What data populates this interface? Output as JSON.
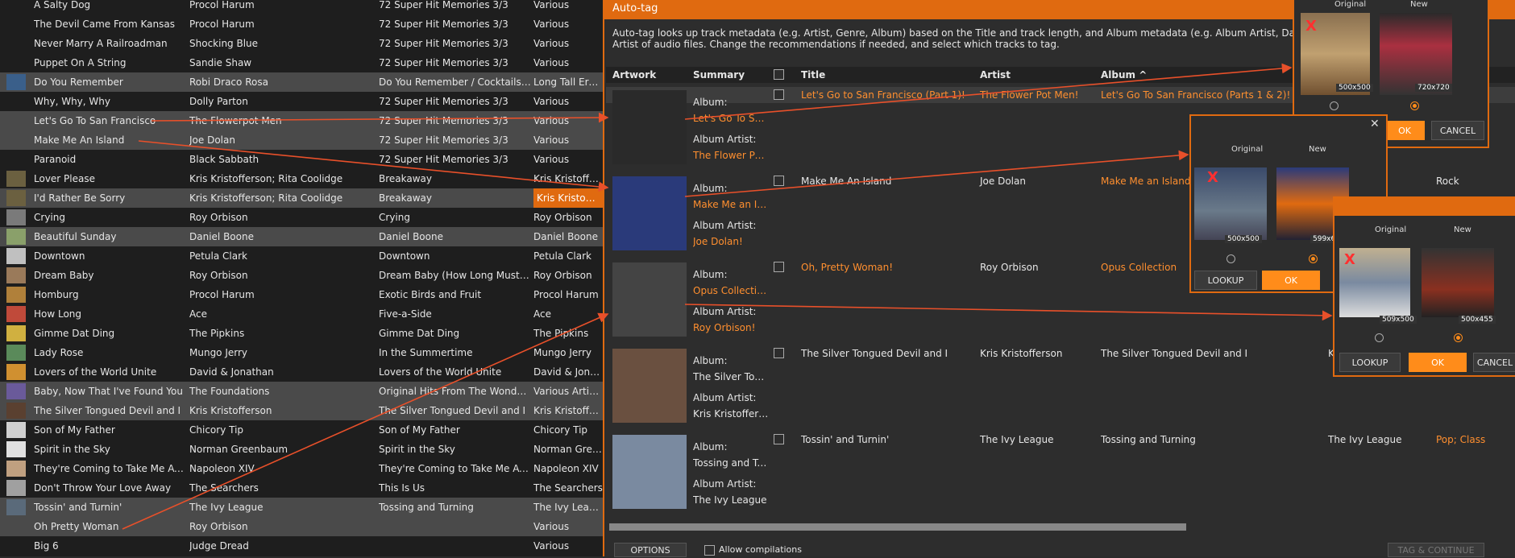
{
  "library": {
    "rows": [
      {
        "title": "A Salty Dog",
        "artist": "Procol Harum",
        "album": "72 Super Hit Memories 3/3",
        "album_artist": "Various",
        "selected": false,
        "thumb": ""
      },
      {
        "title": "The Devil Came From Kansas",
        "artist": "Procol Harum",
        "album": "72 Super Hit Memories 3/3",
        "album_artist": "Various",
        "selected": false,
        "thumb": ""
      },
      {
        "title": "Never Marry A Railroadman",
        "artist": "Shocking Blue",
        "album": "72 Super Hit Memories 3/3",
        "album_artist": "Various",
        "selected": false,
        "thumb": ""
      },
      {
        "title": "Puppet On A String",
        "artist": "Sandie Shaw",
        "album": "72 Super Hit Memories 3/3",
        "album_artist": "Various",
        "selected": false,
        "thumb": ""
      },
      {
        "title": "Do You Remember",
        "artist": "Robi Draco Rosa",
        "album": "Do You Remember / Cocktails At...",
        "album_artist": "Long Tall Ernie ...",
        "selected": true,
        "thumb": "#3a5f8a"
      },
      {
        "title": "Why, Why, Why",
        "artist": "Dolly Parton",
        "album": "72 Super Hit Memories 3/3",
        "album_artist": "Various",
        "selected": false,
        "thumb": ""
      },
      {
        "title": "Let's Go To San Francisco",
        "artist": "The Flowerpot Men",
        "album": "72 Super Hit Memories 3/3",
        "album_artist": "Various",
        "selected": true,
        "thumb": ""
      },
      {
        "title": "Make Me An Island",
        "artist": "Joe Dolan",
        "album": "72 Super Hit Memories 3/3",
        "album_artist": "Various",
        "selected": true,
        "thumb": ""
      },
      {
        "title": "Paranoid",
        "artist": "Black Sabbath",
        "album": "72 Super Hit Memories 3/3",
        "album_artist": "Various",
        "selected": false,
        "thumb": ""
      },
      {
        "title": "Lover Please",
        "artist": "Kris Kristofferson; Rita Coolidge",
        "album": "Breakaway",
        "album_artist": "Kris Kristoffers...",
        "selected": false,
        "thumb": "#6b6040"
      },
      {
        "title": "I'd Rather Be Sorry",
        "artist": "Kris Kristofferson; Rita Coolidge",
        "album": "Breakaway",
        "album_artist": "Kris Kristoffers...",
        "selected": true,
        "thumb": "#6b6040"
      },
      {
        "title": "Crying",
        "artist": "Roy Orbison",
        "album": "Crying",
        "album_artist": "Roy Orbison",
        "selected": false,
        "thumb": "#7a7a7a"
      },
      {
        "title": "Beautiful Sunday",
        "artist": "Daniel Boone",
        "album": "Daniel Boone",
        "album_artist": "Daniel Boone",
        "selected": true,
        "thumb": "#8aa06a"
      },
      {
        "title": "Downtown",
        "artist": "Petula Clark",
        "album": "Downtown",
        "album_artist": "Petula Clark",
        "selected": false,
        "thumb": "#c0c0c0"
      },
      {
        "title": "Dream Baby",
        "artist": "Roy Orbison",
        "album": "Dream Baby (How Long Must I Dr...",
        "album_artist": "Roy Orbison",
        "selected": false,
        "thumb": "#9a7a5a"
      },
      {
        "title": "Homburg",
        "artist": "Procol Harum",
        "album": "Exotic Birds and Fruit",
        "album_artist": "Procol Harum",
        "selected": false,
        "thumb": "#b0803a"
      },
      {
        "title": "How Long",
        "artist": "Ace",
        "album": "Five-a-Side",
        "album_artist": "Ace",
        "selected": false,
        "thumb": "#c04a3a"
      },
      {
        "title": "Gimme Dat Ding",
        "artist": "The Pipkins",
        "album": "Gimme Dat Ding",
        "album_artist": "The Pipkins",
        "selected": false,
        "thumb": "#d0b040"
      },
      {
        "title": "Lady Rose",
        "artist": "Mungo Jerry",
        "album": "In the Summertime",
        "album_artist": "Mungo Jerry",
        "selected": false,
        "thumb": "#5a8a5a"
      },
      {
        "title": "Lovers of the World Unite",
        "artist": "David & Jonathan",
        "album": "Lovers of the World Unite",
        "album_artist": "David & Jonath...",
        "selected": false,
        "thumb": "#d09030"
      },
      {
        "title": "Baby, Now That I've Found You",
        "artist": "The Foundations",
        "album": "Original Hits From The Wonder Y...",
        "album_artist": "Various Artists",
        "selected": true,
        "thumb": "#6a5a9a"
      },
      {
        "title": "The Silver Tongued Devil and I",
        "artist": "Kris Kristofferson",
        "album": "The Silver Tongued Devil and I",
        "album_artist": "Kris Kristoffers...",
        "selected": true,
        "thumb": "#5a4030"
      },
      {
        "title": "Son of My Father",
        "artist": "Chicory Tip",
        "album": "Son of My Father",
        "album_artist": "Chicory Tip",
        "selected": false,
        "thumb": "#d0d0d0"
      },
      {
        "title": "Spirit in the Sky",
        "artist": "Norman Greenbaum",
        "album": "Spirit in the Sky",
        "album_artist": "Norman Green...",
        "selected": false,
        "thumb": "#e0e0e0"
      },
      {
        "title": "They're Coming to Take Me Away...",
        "artist": "Napoleon XIV",
        "album": "They're Coming to Take Me Away...",
        "album_artist": "Napoleon XIV",
        "selected": false,
        "thumb": "#c0a080"
      },
      {
        "title": "Don't Throw Your Love Away",
        "artist": "The Searchers",
        "album": "This Is Us",
        "album_artist": "The Searchers",
        "selected": false,
        "thumb": "#a0a0a0"
      },
      {
        "title": "Tossin' and Turnin'",
        "artist": "The Ivy League",
        "album": "Tossing and Turning",
        "album_artist": "The Ivy League",
        "selected": true,
        "thumb": "#5a6a7a"
      },
      {
        "title": "Oh Pretty Woman",
        "artist": "Roy Orbison",
        "album": "",
        "album_artist": "Various",
        "selected": true,
        "thumb": ""
      },
      {
        "title": "Big 6",
        "artist": "Judge Dread",
        "album": "",
        "album_artist": "Various",
        "selected": false,
        "thumb": ""
      }
    ]
  },
  "dialog": {
    "title": "Auto-tag",
    "description": "Auto-tag looks up track metadata (e.g. Artist, Genre, Album) based on the Title and track length, and Album metadata (e.g. Album Artist, Date) based on the Album and Album Artist of audio files. Change the recommendations if needed, and select which tracks to tag.",
    "columns": {
      "artwork": "Artwork",
      "summary": "Summary",
      "title": "Title",
      "artist": "Artist",
      "album": "Album ^"
    },
    "album_key": "Album:",
    "album_artist_key": "Album Artist:",
    "rows": [
      {
        "album": "Let's Go To San...",
        "album_artist": "The Flower Pot ...",
        "title": "Let's Go to San Francisco (Part 1)!",
        "artist": "The Flower Pot Men!",
        "album_full": "Let's Go To San Francisco (Parts 1 & 2)!",
        "col6": "",
        "col7": "",
        "orange": true,
        "art": "#2a2a2a"
      },
      {
        "album": "Make Me an Isl...",
        "album_artist": "Joe Dolan!",
        "title": "Make Me An Island",
        "artist": "Joe Dolan",
        "album_full": "Make Me an Island / ...",
        "col6": "",
        "col7": "Rock",
        "orange_album": true,
        "art": "#2a3a7a"
      },
      {
        "album": "Opus Collection",
        "album_artist": "Roy Orbison!",
        "title": "Oh, Pretty Woman!",
        "artist": "Roy Orbison",
        "album_full": "Opus Collection",
        "col6": "",
        "col7": "",
        "orange_title": true,
        "art": "#444"
      },
      {
        "album": "The Silver Tong...",
        "album_artist": "Kris Kristoffers...",
        "title": "The Silver Tongued Devil and I",
        "artist": "Kris Kristofferson",
        "album_full": "The Silver Tongued Devil and I",
        "col6": "Kr",
        "col7": "",
        "art": "#6a5040"
      },
      {
        "album": "Tossing and Tu...",
        "album_artist": "The Ivy League",
        "title": "Tossin' and Turnin'",
        "artist": "The Ivy League",
        "album_full": "Tossing and Turning",
        "col6": "The Ivy League",
        "col7": "Pop; Class",
        "art": "#7a8aa0"
      }
    ],
    "options_label": "OPTIONS",
    "allow_compilations_label": "Allow compilations",
    "tag_continue_label": "TAG & CONTINUE"
  },
  "popups": [
    {
      "original_label": "Original",
      "new_label": "New",
      "orig_dim": "500x500",
      "new_dim": "720x720",
      "ok": "OK",
      "cancel": "CANCEL"
    },
    {
      "original_label": "Original",
      "new_label": "New",
      "orig_dim": "500x500",
      "new_dim": "599x6...",
      "lookup": "LOOKUP",
      "ok": "OK"
    },
    {
      "original_label": "Original",
      "new_label": "New",
      "orig_dim": "509x500",
      "new_dim": "500x455",
      "lookup": "LOOKUP",
      "ok": "OK",
      "cancel": "CANCEL"
    }
  ],
  "colors": {
    "accent": "#e06a10",
    "button_orange": "#ff8c1a",
    "text_orange": "#ff8f2f",
    "arrow": "#e8502a"
  }
}
